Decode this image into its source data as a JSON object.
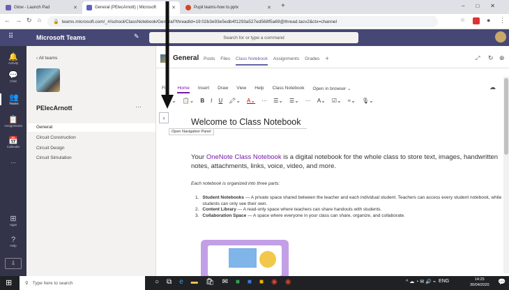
{
  "browser": {
    "tabs": [
      {
        "label": "Glow - Launch Pad",
        "color": "#6b5fb5"
      },
      {
        "label": "General (PElecArnott) | Microsoft",
        "color": "#5b5fc7"
      },
      {
        "label": "Pupil teams-how to.pptx",
        "color": "#d24726"
      }
    ],
    "new_tab": "+",
    "url": "teams.microsoft.com/_#/school/ClassNotebook/General?threadId=19:02b3e93e5edb4f1293a527ed568f5a69@thread.tacv2&ctx=channel",
    "window_controls": [
      "–",
      "□",
      "✕"
    ]
  },
  "teams": {
    "app_name": "Microsoft Teams",
    "search_placeholder": "Search for or type a command",
    "rail": [
      {
        "label": "Activity",
        "icon": "🔔"
      },
      {
        "label": "Chat",
        "icon": "💬"
      },
      {
        "label": "Teams",
        "icon": "👥"
      },
      {
        "label": "Assignments",
        "icon": "📋"
      },
      {
        "label": "Calendar",
        "icon": "📅"
      },
      {
        "label": "...",
        "icon": ""
      },
      {
        "label": "Apps",
        "icon": "⊞"
      },
      {
        "label": "Help",
        "icon": "?"
      }
    ],
    "back_label": "All teams",
    "team_name": "PElecArnott",
    "team_more": "···",
    "channels": [
      "General",
      "Circuit Construction",
      "Circuit Design",
      "Circuit Simulation"
    ],
    "channel_title": "General",
    "channel_tabs": [
      "Posts",
      "Files",
      "Class Notebook",
      "Assignments",
      "Grades"
    ],
    "add_tab": "+"
  },
  "onenote": {
    "ribbon_tabs": [
      "File",
      "Home",
      "Insert",
      "Draw",
      "View",
      "Help",
      "Class Notebook"
    ],
    "open_browser": "Open in browser ⌄",
    "tooltip": "Open Navigation Panel",
    "page_title": "Welcome to Class Notebook",
    "intro_pre": "Your ",
    "intro_link": "OneNote Class Notebook",
    "intro_post": " is a digital notebook for the whole class to store text, images, handwritten notes, attachments, links, voice, video, and more.",
    "parts_intro": "Each notebook is organized into three parts:",
    "parts": [
      {
        "num": "1.",
        "name": "Student Notebooks",
        "text": " — A private space shared between the teacher and each individual student. Teachers can access every student notebook, while students can only see their own."
      },
      {
        "num": "2.",
        "name": "Content Library",
        "text": " — A read-only space where teachers can share handouts with students."
      },
      {
        "num": "3.",
        "name": "Collaboration Space",
        "text": " — A space where everyone in your class can share, organize, and collaborate."
      }
    ]
  },
  "taskbar": {
    "search_placeholder": "Type here to search",
    "lang": "ENG",
    "time": "14:25",
    "date": "30/04/2020"
  }
}
